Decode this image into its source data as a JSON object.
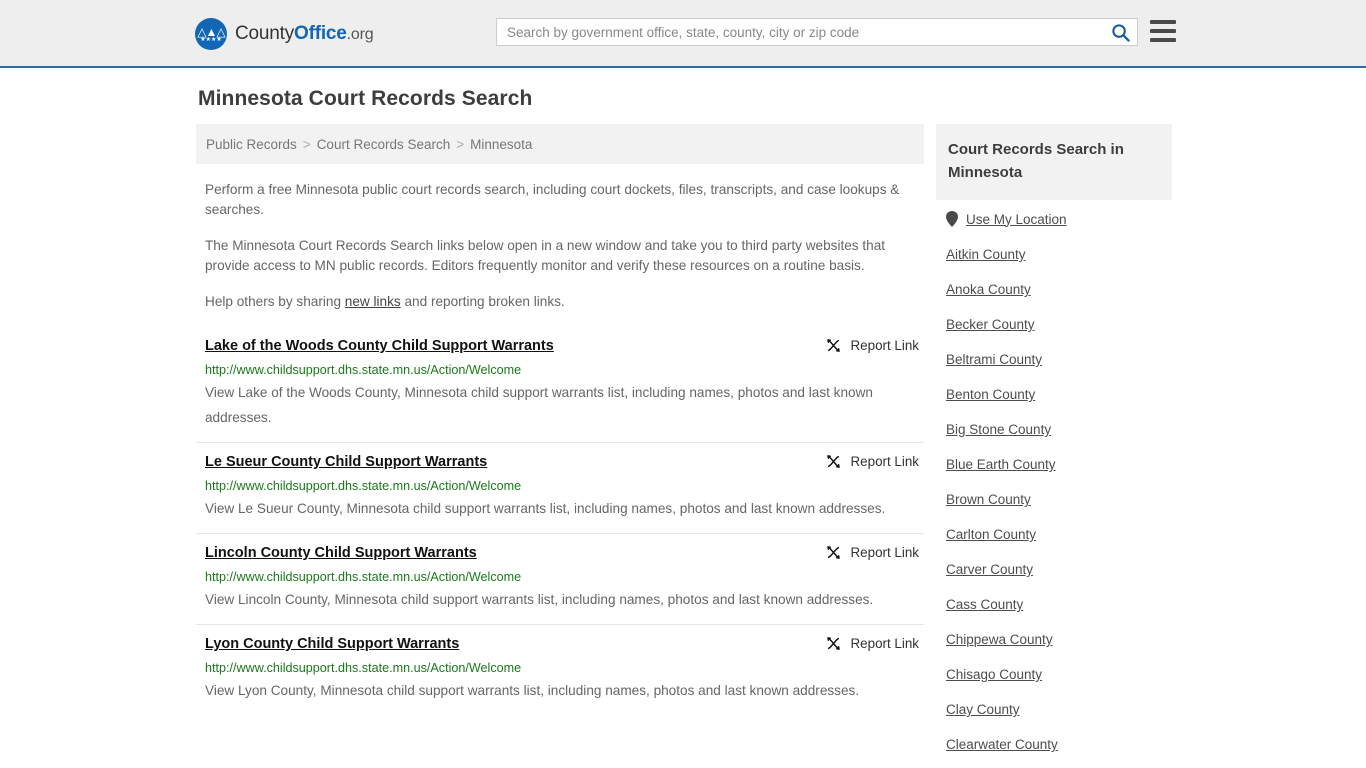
{
  "header": {
    "logo": {
      "icon": "eagle-seal-icon",
      "text_county": "County",
      "text_office": "Office",
      "text_org": ".org"
    },
    "search": {
      "placeholder": "Search by government office, state, county, city or zip code",
      "value": "",
      "button_icon": "search-icon"
    },
    "menu_icon": "hamburger-menu-icon"
  },
  "page": {
    "title": "Minnesota Court Records Search"
  },
  "breadcrumb": {
    "items": [
      {
        "label": "Public Records"
      },
      {
        "label": "Court Records Search"
      },
      {
        "label": "Minnesota"
      }
    ],
    "separator": ">"
  },
  "intro": {
    "p1": "Perform a free Minnesota public court records search, including court dockets, files, transcripts, and case lookups & searches.",
    "p2": "The Minnesota Court Records Search links below open in a new window and take you to third party websites that provide access to MN public records. Editors frequently monitor and verify these resources on a routine basis.",
    "p3_before": "Help others by sharing ",
    "p3_link": "new links",
    "p3_after": " and reporting broken links."
  },
  "results": {
    "report_label": "Report Link",
    "report_icon": "broken-link-icon",
    "items": [
      {
        "title": "Lake of the Woods County Child Support Warrants",
        "url": "http://www.childsupport.dhs.state.mn.us/Action/Welcome",
        "description": "View Lake of the Woods County, Minnesota child support warrants list, including names, photos and last known addresses."
      },
      {
        "title": "Le Sueur County Child Support Warrants",
        "url": "http://www.childsupport.dhs.state.mn.us/Action/Welcome",
        "description": "View Le Sueur County, Minnesota child support warrants list, including names, photos and last known addresses."
      },
      {
        "title": "Lincoln County Child Support Warrants",
        "url": "http://www.childsupport.dhs.state.mn.us/Action/Welcome",
        "description": "View Lincoln County, Minnesota child support warrants list, including names, photos and last known addresses."
      },
      {
        "title": "Lyon County Child Support Warrants",
        "url": "http://www.childsupport.dhs.state.mn.us/Action/Welcome",
        "description": "View Lyon County, Minnesota child support warrants list, including names, photos and last known addresses."
      }
    ]
  },
  "sidebar": {
    "heading": "Court Records Search in Minnesota",
    "use_location": {
      "icon": "map-pin-icon",
      "label": "Use My Location"
    },
    "counties": [
      {
        "label": "Aitkin County"
      },
      {
        "label": "Anoka County"
      },
      {
        "label": "Becker County"
      },
      {
        "label": "Beltrami County"
      },
      {
        "label": "Benton County"
      },
      {
        "label": "Big Stone County"
      },
      {
        "label": "Blue Earth County"
      },
      {
        "label": "Brown County"
      },
      {
        "label": "Carlton County"
      },
      {
        "label": "Carver County"
      },
      {
        "label": "Cass County"
      },
      {
        "label": "Chippewa County"
      },
      {
        "label": "Chisago County"
      },
      {
        "label": "Clay County"
      },
      {
        "label": "Clearwater County"
      }
    ]
  },
  "colors": {
    "brand_blue": "#1266b4",
    "header_bg": "#eeeeee",
    "header_border": "#2c6ca4",
    "url_green": "#1a7a1a",
    "panel_gray": "#f2f2f2"
  }
}
